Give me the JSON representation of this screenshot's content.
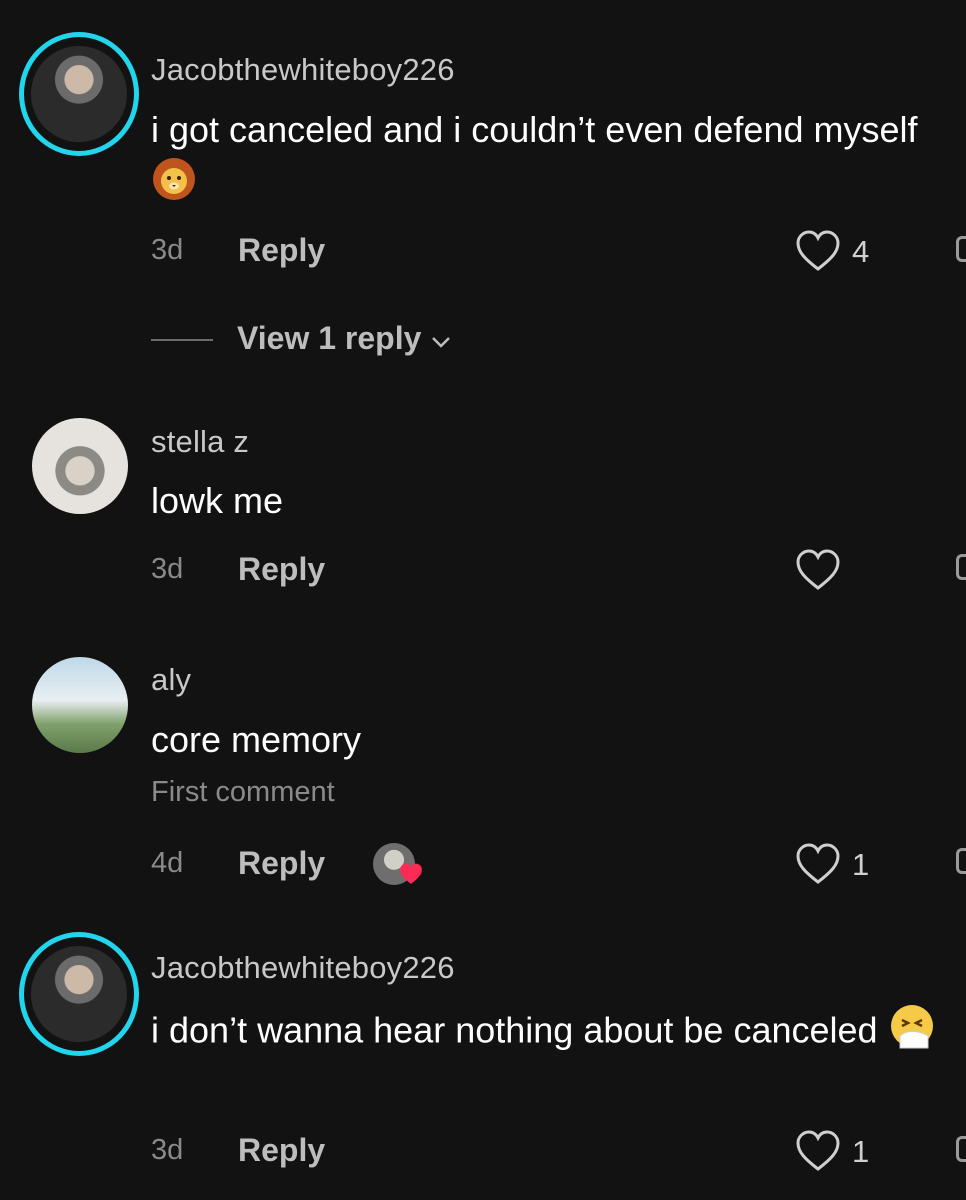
{
  "comments": [
    {
      "username": "Jacobthewhiteboy226",
      "text": "i got canceled and i couldn’t even defend myself",
      "emoji": "lion-face",
      "age": "3d",
      "reply_label": "Reply",
      "likes": "4",
      "view_replies": "View 1 reply"
    },
    {
      "username": "stella z",
      "text": "lowk me",
      "age": "3d",
      "reply_label": "Reply",
      "likes": ""
    },
    {
      "username": "aly",
      "text": "core memory",
      "tag": "First comment",
      "age": "4d",
      "reply_label": "Reply",
      "likes": "1"
    },
    {
      "username": "Jacobthewhiteboy226",
      "text": "i don’t wanna hear nothing about be canceled",
      "emoji": "sneezing-face",
      "age": "3d",
      "reply_label": "Reply",
      "likes": "1"
    }
  ],
  "colors": {
    "background": "#121212",
    "story_ring": "#20d5ec",
    "creator_like_heart": "#fe2c55"
  }
}
